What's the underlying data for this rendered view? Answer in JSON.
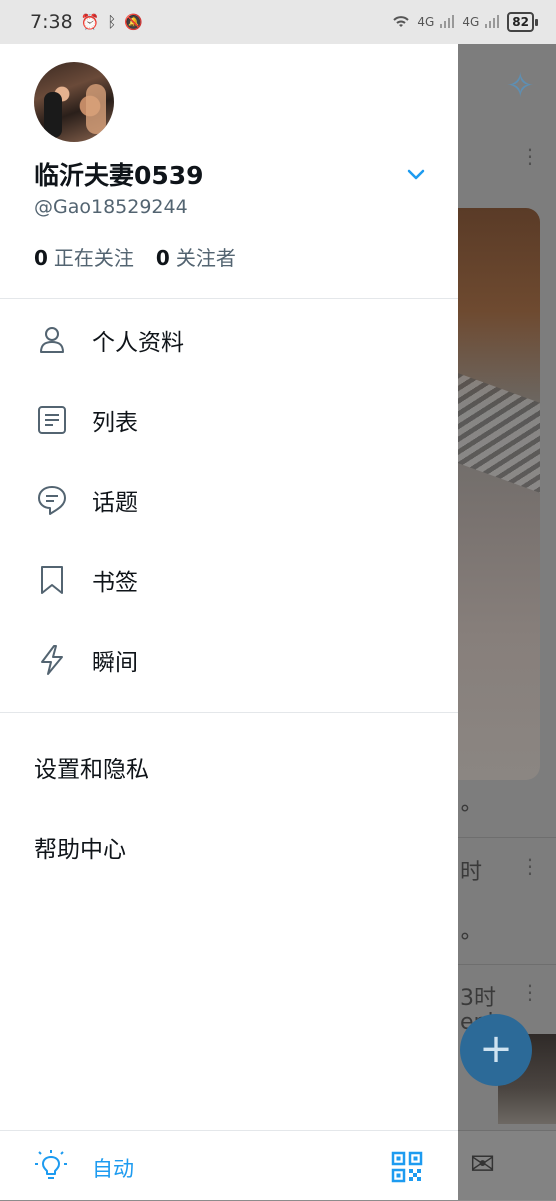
{
  "status_bar": {
    "time": "7:38",
    "battery": "82",
    "net1": "4G",
    "net2": "4G"
  },
  "profile": {
    "display_name": "临沂夫妻0539",
    "handle": "@Gao18529244",
    "following_count": "0",
    "following_label": "正在关注",
    "followers_count": "0",
    "followers_label": "关注者"
  },
  "menu": {
    "items": [
      {
        "label": "个人资料",
        "icon": "person-icon"
      },
      {
        "label": "列表",
        "icon": "list-icon"
      },
      {
        "label": "话题",
        "icon": "topics-icon"
      },
      {
        "label": "书签",
        "icon": "bookmark-icon"
      },
      {
        "label": "瞬间",
        "icon": "lightning-icon"
      }
    ],
    "secondary": [
      {
        "label": "设置和隐私"
      },
      {
        "label": "帮助中心"
      }
    ]
  },
  "footer": {
    "display_mode_label": "自动"
  },
  "background": {
    "snippet1": "时",
    "snippet2": "3时",
    "snippet3": "eni"
  },
  "colors": {
    "accent": "#1d9bf0",
    "text": "#0f1419",
    "secondary_text": "#536471"
  }
}
